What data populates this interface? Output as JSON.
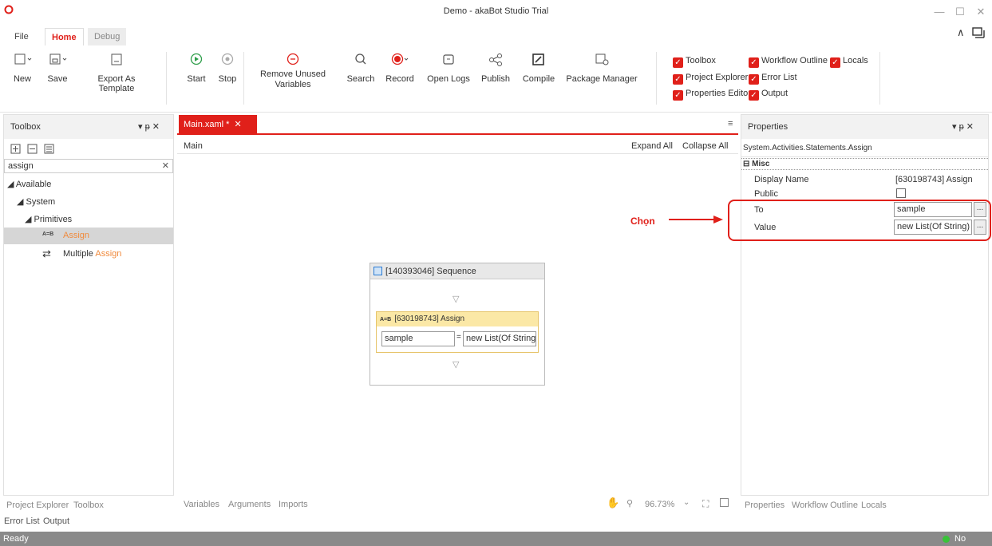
{
  "window": {
    "title": "Demo - akaBot Studio Trial"
  },
  "ribbon": {
    "tabs": [
      {
        "label": "File"
      },
      {
        "label": "Home"
      },
      {
        "label": "Debug"
      }
    ],
    "buttons": {
      "new": "New",
      "save": "Save",
      "export": "Export As Template",
      "start": "Start",
      "stop": "Stop",
      "remove_unused_1": "Remove Unused",
      "remove_unused_2": "Variables",
      "search": "Search",
      "record": "Record",
      "open_logs": "Open Logs",
      "publish": "Publish",
      "compile": "Compile",
      "package_manager": "Package Manager"
    },
    "checks": {
      "toolbox": "Toolbox",
      "workflow_outline": "Workflow Outline",
      "locals": "Locals",
      "project_explorer": "Project Explorer",
      "error_list": "Error List",
      "properties_editor": "Properties Editor",
      "output": "Output"
    }
  },
  "toolbox": {
    "title": "Toolbox",
    "search_value": "assign",
    "tree": {
      "available": "Available",
      "system": "System",
      "primitives": "Primitives",
      "assign_icon_text": "A=B",
      "assign": "Assign",
      "multiple": "Multiple ",
      "multiple_assign": "Assign"
    }
  },
  "designer": {
    "tab": "Main.xaml *",
    "breadcrumb": "Main",
    "expand_all": "Expand All",
    "collapse_all": "Collapse All",
    "sequence_title": "[140393046] Sequence",
    "assign_icon_text": "A=B",
    "assign_title": "[630198743] Assign",
    "assign_to": "sample",
    "assign_eq": "=",
    "assign_value": "new List(Of String)",
    "bottom_tabs": {
      "variables": "Variables",
      "arguments": "Arguments",
      "imports": "Imports"
    },
    "zoom": "96.73%"
  },
  "annotation": {
    "text": "Chọn",
    "color": "#e0201a"
  },
  "properties": {
    "title": "Properties",
    "type": "System.Activities.Statements.Assign",
    "category": "Misc",
    "rows": {
      "display_name_label": "Display Name",
      "display_name_value": "[630198743] Assign",
      "public_label": "Public",
      "to_label": "To",
      "to_value": "sample",
      "value_label": "Value",
      "value_value": "new List(Of String) F"
    },
    "ellipsis": "...",
    "bottom_tabs": {
      "properties": "Properties",
      "workflow_outline": "Workflow Outline",
      "locals": "Locals"
    }
  },
  "left_bottom_tabs": {
    "project_explorer": "Project Explorer",
    "toolbox": "Toolbox",
    "error_list": "Error List",
    "output": "Output"
  },
  "status": {
    "left": "Ready",
    "right": "No Errors"
  },
  "colors": {
    "accent": "#e0201a",
    "highlight_orange": "#f08a3c",
    "status_ok": "#39c339"
  }
}
